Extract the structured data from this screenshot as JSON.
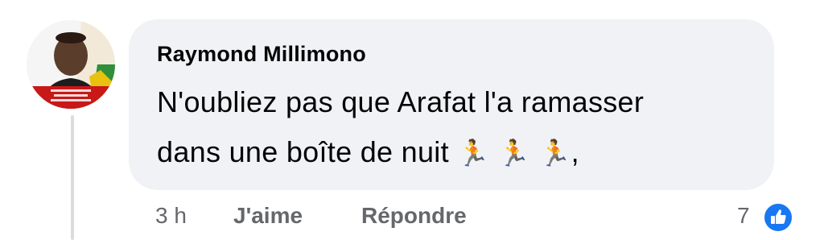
{
  "comment": {
    "author": "Raymond Millimono",
    "text_line1": "N'oubliez pas que Arafat l'a ramasser",
    "text_line2": "dans une boîte de nuit",
    "emoji": "🏃 🏃 🏃",
    "trailing": ","
  },
  "actions": {
    "timestamp": "3 h",
    "like_label": "J'aime",
    "reply_label": "Répondre",
    "reaction_count": "7",
    "reaction_icon": "thumbs-up-icon"
  },
  "colors": {
    "bubble": "#f0f2f5",
    "meta_text": "#65676b",
    "like_badge": "#1877f2"
  }
}
